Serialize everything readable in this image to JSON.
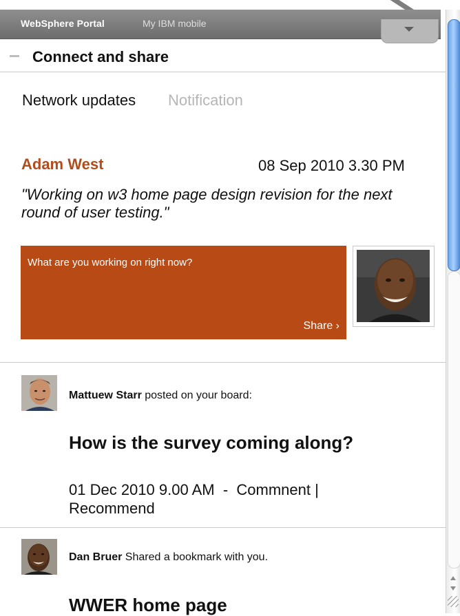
{
  "portal": {
    "brand": "WebSphere Portal",
    "link": "My IBM mobile",
    "menu_icon": "dropdown-caret"
  },
  "section": {
    "title": "Connect and share",
    "collapse_icon": "minus"
  },
  "tabs": [
    {
      "label": "Network updates",
      "active": true
    },
    {
      "label": "Notification",
      "active": false
    }
  ],
  "update": {
    "author": "Adam West",
    "time": "08 Sep 2010 3.30 PM",
    "quote": "\"Working on w3 home page design revision for the next round of user testing.\""
  },
  "status": {
    "prompt": "What are you working on right now?",
    "share_label": "Share ›"
  },
  "activities": [
    {
      "name": "Mattuew Starr",
      "action": " posted on your board:",
      "title": "How is the survey coming along?",
      "date": "01 Dec 2010 9.00 AM",
      "separator": "  -  ",
      "comment": "Commnent",
      "pipe": " |",
      "recommend": "Recommend"
    },
    {
      "name": "Dan Bruer",
      "action": " Shared a bookmark with you.",
      "title": "WWER home page"
    }
  ],
  "colors": {
    "accent": "#b84a16",
    "author": "#b14d1c",
    "header_bar": "#7a7a7a",
    "scroll_thumb": "#6fa6e6"
  }
}
